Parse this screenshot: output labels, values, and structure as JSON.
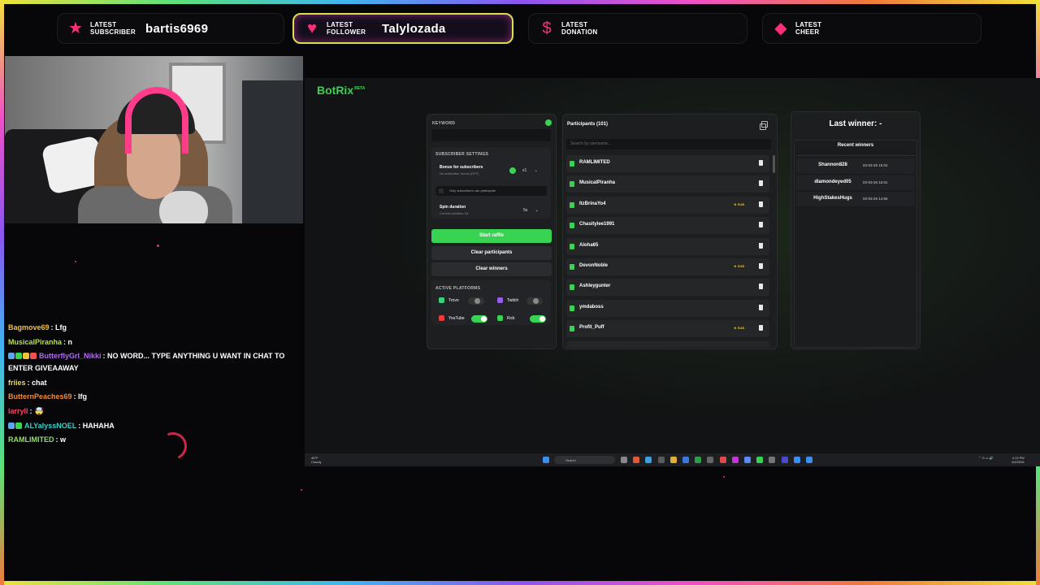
{
  "alerts": [
    {
      "label_line1": "LATEST",
      "label_line2": "SUBSCRIBER",
      "value": "bartis6969",
      "icon": "star-icon"
    },
    {
      "label_line1": "LATEST",
      "label_line2": "FOLLOWER",
      "value": "Talylozada",
      "icon": "heart-icon"
    },
    {
      "label_line1": "LATEST",
      "label_line2": "DONATION",
      "value": "",
      "icon": "dollar-icon"
    },
    {
      "label_line1": "LATEST",
      "label_line2": "CHEER",
      "value": "",
      "icon": "gem-icon"
    }
  ],
  "chat": [
    {
      "user": "Bagmove69",
      "color": "#f0c23a",
      "text": ": Lfg",
      "badges": []
    },
    {
      "user": "MusicalPiranha",
      "color": "#b8e04a",
      "text": ": n",
      "badges": []
    },
    {
      "user": "ButterflyGrl_Nikki",
      "color": "#b06cf0",
      "text": ": NO WORD... TYPE ANYTHING U WANT IN CHAT TO ENTER GIVEAAWAY",
      "badges": [
        "#5aa6f0",
        "#39d353",
        "#f0c23a",
        "#f05050"
      ]
    },
    {
      "user": "friies",
      "color": "#f0d84a",
      "text": ": chat",
      "badges": []
    },
    {
      "user": "ButternPeaches69",
      "color": "#f08a3a",
      "text": ": lfg",
      "badges": []
    },
    {
      "user": "larryll",
      "color": "#f04a6a",
      "text": ":",
      "badges": [],
      "emote": "🤯"
    },
    {
      "user": "ALYalyssNOEL",
      "color": "#3ad0c8",
      "text": ": HAHAHA",
      "badges": [
        "#5aa6f0",
        "#39d353"
      ]
    },
    {
      "user": "RAMLIMITED",
      "color": "#8fe06a",
      "text": ": w",
      "badges": []
    }
  ],
  "botrix": {
    "brand": "BotRix",
    "brand_tag": "BETA",
    "keyword_label": "KEYWORD",
    "subscriber_settings_label": "SUBSCRIBER SETTINGS",
    "bonus_label": "Bonus for subscribers",
    "bonus_sub": "No subscriber bonus (OFF)",
    "bonus_value": "x1",
    "only_subs_label": "Only subscribers can participate",
    "spin_label": "Spin duration",
    "spin_sub": "Current duration: 5s",
    "spin_value": "5s",
    "start_label": "Start raffle",
    "clear_participants_label": "Clear participants",
    "clear_winners_label": "Clear winners",
    "platforms_label": "ACTIVE PLATFORMS",
    "platforms": [
      {
        "name": "Trovo",
        "color": "#39d37a",
        "on": false
      },
      {
        "name": "Twitch",
        "color": "#9b5cf0",
        "on": false
      },
      {
        "name": "YouTube",
        "color": "#f03a3a",
        "on": true
      },
      {
        "name": "Kick",
        "color": "#39d353",
        "on": true
      }
    ],
    "participants_title": "Participants (101)",
    "search_placeholder": "Search by username...",
    "sub_tag": "★ SUB",
    "participants": [
      {
        "name": "RAMLIMITED",
        "sub": false
      },
      {
        "name": "MusicalPiranha",
        "sub": false
      },
      {
        "name": "ItzBrinaYo4",
        "sub": true
      },
      {
        "name": "Chasitylee1991",
        "sub": false
      },
      {
        "name": "Aloha65",
        "sub": false
      },
      {
        "name": "DevonNoble",
        "sub": true
      },
      {
        "name": "Ashleygunter",
        "sub": false
      },
      {
        "name": "ymdaboss",
        "sub": false
      },
      {
        "name": "Profit_Puff",
        "sub": true
      }
    ],
    "last_winner": "Last winner: -",
    "recent_winners_title": "Recent winners",
    "recent_winners": [
      {
        "name": "Shannon828",
        "date": "03-03-26 15:02"
      },
      {
        "name": "diamondeyed05",
        "date": "03-03-26 15:01"
      },
      {
        "name": "HighStakesHugs",
        "date": "03-03-26 14:56"
      }
    ]
  },
  "taskbar": {
    "weather_temp": "45°F",
    "weather_desc": "Cloudy",
    "search_placeholder": "Search",
    "time": "4:13 PM",
    "date": "3/4/2026"
  }
}
